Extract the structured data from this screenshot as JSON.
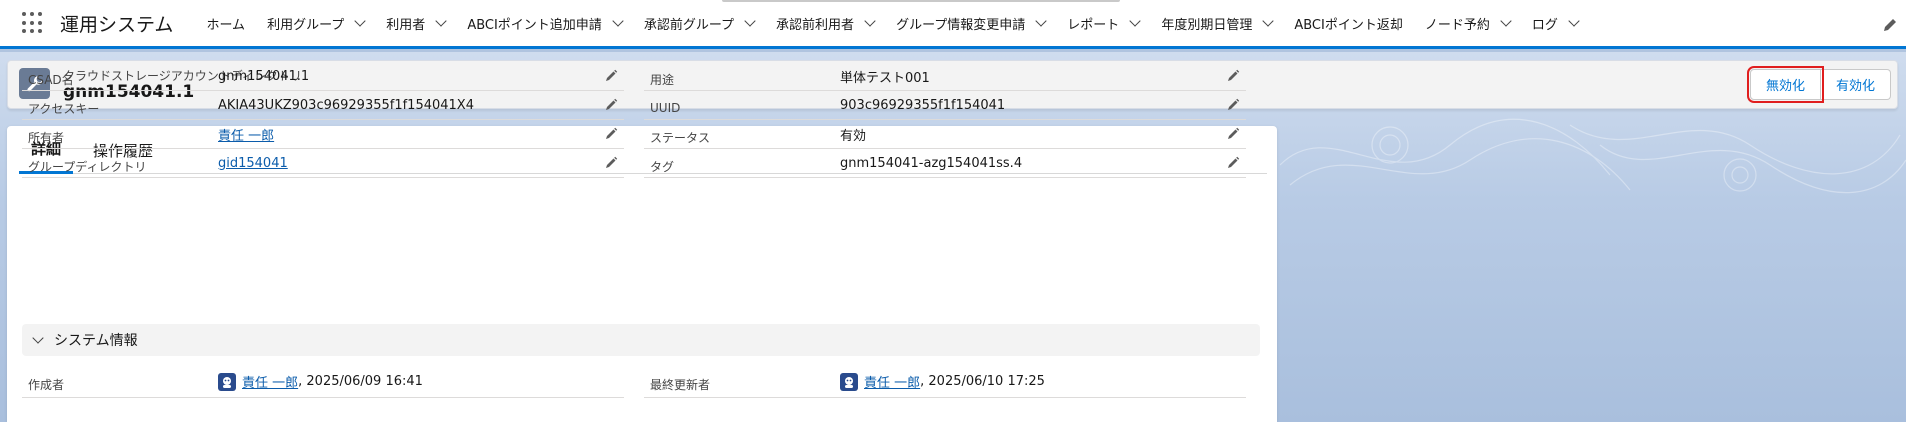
{
  "app": {
    "name": "運用システム"
  },
  "nav": {
    "items": [
      {
        "label": "ホーム",
        "dropdown": false
      },
      {
        "label": "利用グループ",
        "dropdown": true
      },
      {
        "label": "利用者",
        "dropdown": true
      },
      {
        "label": "ABCIポイント追加申請",
        "dropdown": true
      },
      {
        "label": "承認前グループ",
        "dropdown": true
      },
      {
        "label": "承認前利用者",
        "dropdown": true
      },
      {
        "label": "グループ情報変更申請",
        "dropdown": true
      },
      {
        "label": "レポート",
        "dropdown": true
      },
      {
        "label": "年度別期日管理",
        "dropdown": true
      },
      {
        "label": "ABCIポイント返却",
        "dropdown": false
      },
      {
        "label": "ノード予約",
        "dropdown": true
      },
      {
        "label": "ログ",
        "dropdown": true
      }
    ]
  },
  "header": {
    "object_type": "クラウドストレージアカウントディレクトリ",
    "title": "gnm154041.1",
    "buttons": {
      "disable": "無効化",
      "enable": "有効化"
    }
  },
  "tabs": [
    {
      "label": "詳細",
      "active": true
    },
    {
      "label": "操作履歴",
      "active": false
    }
  ],
  "details": {
    "left": [
      {
        "label": "CSAD名",
        "value": "gnm154041.1",
        "link": false
      },
      {
        "label": "アクセスキー",
        "value": "AKIA43UKZ903c96929355f1f154041X4",
        "link": false
      },
      {
        "label": "所有者",
        "value": "責任 一郎",
        "link": true
      },
      {
        "label": "グループディレクトリ",
        "value": "gid154041",
        "link": true
      }
    ],
    "right": [
      {
        "label": "用途",
        "value": "単体テスト001",
        "link": false
      },
      {
        "label": "UUID",
        "value": "903c96929355f1f154041",
        "link": false
      },
      {
        "label": "ステータス",
        "value": "有効",
        "link": false
      },
      {
        "label": "タグ",
        "value": "gnm154041-azg154041ss.4",
        "link": false
      }
    ]
  },
  "system_info": {
    "section_title": "システム情報",
    "created_by": {
      "label": "作成者",
      "user": "責任 一郎",
      "date": ", 2025/06/09 16:41"
    },
    "modified_by": {
      "label": "最終更新者",
      "user": "責任 一郎",
      "date": ", 2025/06/10 17:25"
    }
  },
  "colors": {
    "brand": "#0176d3",
    "highlight": "#e01e1e",
    "link": "#0b5cab"
  }
}
